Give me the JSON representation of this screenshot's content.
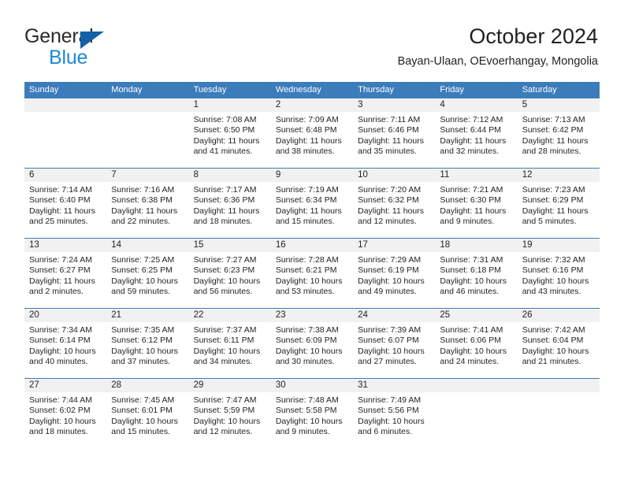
{
  "brand": {
    "name_part1": "General",
    "name_part2": "Blue",
    "accent_color": "#2089d4",
    "triangle_color": "#1461a8",
    "logo_icon": "triangle-icon"
  },
  "header": {
    "title": "October 2024",
    "subtitle": "Bayan-Ulaan, OEvoerhangay, Mongolia"
  },
  "theme": {
    "header_row_bg": "#3b7cbb",
    "day_band_bg": "#f1f1f1",
    "text_color": "#231f20"
  },
  "calendar": {
    "weekday_headers": [
      "Sunday",
      "Monday",
      "Tuesday",
      "Wednesday",
      "Thursday",
      "Friday",
      "Saturday"
    ],
    "weeks": [
      [
        {
          "day": "",
          "lines": []
        },
        {
          "day": "",
          "lines": []
        },
        {
          "day": "1",
          "lines": [
            "Sunrise: 7:08 AM",
            "Sunset: 6:50 PM",
            "Daylight: 11 hours",
            "and 41 minutes."
          ]
        },
        {
          "day": "2",
          "lines": [
            "Sunrise: 7:09 AM",
            "Sunset: 6:48 PM",
            "Daylight: 11 hours",
            "and 38 minutes."
          ]
        },
        {
          "day": "3",
          "lines": [
            "Sunrise: 7:11 AM",
            "Sunset: 6:46 PM",
            "Daylight: 11 hours",
            "and 35 minutes."
          ]
        },
        {
          "day": "4",
          "lines": [
            "Sunrise: 7:12 AM",
            "Sunset: 6:44 PM",
            "Daylight: 11 hours",
            "and 32 minutes."
          ]
        },
        {
          "day": "5",
          "lines": [
            "Sunrise: 7:13 AM",
            "Sunset: 6:42 PM",
            "Daylight: 11 hours",
            "and 28 minutes."
          ]
        }
      ],
      [
        {
          "day": "6",
          "lines": [
            "Sunrise: 7:14 AM",
            "Sunset: 6:40 PM",
            "Daylight: 11 hours",
            "and 25 minutes."
          ]
        },
        {
          "day": "7",
          "lines": [
            "Sunrise: 7:16 AM",
            "Sunset: 6:38 PM",
            "Daylight: 11 hours",
            "and 22 minutes."
          ]
        },
        {
          "day": "8",
          "lines": [
            "Sunrise: 7:17 AM",
            "Sunset: 6:36 PM",
            "Daylight: 11 hours",
            "and 18 minutes."
          ]
        },
        {
          "day": "9",
          "lines": [
            "Sunrise: 7:19 AM",
            "Sunset: 6:34 PM",
            "Daylight: 11 hours",
            "and 15 minutes."
          ]
        },
        {
          "day": "10",
          "lines": [
            "Sunrise: 7:20 AM",
            "Sunset: 6:32 PM",
            "Daylight: 11 hours",
            "and 12 minutes."
          ]
        },
        {
          "day": "11",
          "lines": [
            "Sunrise: 7:21 AM",
            "Sunset: 6:30 PM",
            "Daylight: 11 hours",
            "and 9 minutes."
          ]
        },
        {
          "day": "12",
          "lines": [
            "Sunrise: 7:23 AM",
            "Sunset: 6:29 PM",
            "Daylight: 11 hours",
            "and 5 minutes."
          ]
        }
      ],
      [
        {
          "day": "13",
          "lines": [
            "Sunrise: 7:24 AM",
            "Sunset: 6:27 PM",
            "Daylight: 11 hours",
            "and 2 minutes."
          ]
        },
        {
          "day": "14",
          "lines": [
            "Sunrise: 7:25 AM",
            "Sunset: 6:25 PM",
            "Daylight: 10 hours",
            "and 59 minutes."
          ]
        },
        {
          "day": "15",
          "lines": [
            "Sunrise: 7:27 AM",
            "Sunset: 6:23 PM",
            "Daylight: 10 hours",
            "and 56 minutes."
          ]
        },
        {
          "day": "16",
          "lines": [
            "Sunrise: 7:28 AM",
            "Sunset: 6:21 PM",
            "Daylight: 10 hours",
            "and 53 minutes."
          ]
        },
        {
          "day": "17",
          "lines": [
            "Sunrise: 7:29 AM",
            "Sunset: 6:19 PM",
            "Daylight: 10 hours",
            "and 49 minutes."
          ]
        },
        {
          "day": "18",
          "lines": [
            "Sunrise: 7:31 AM",
            "Sunset: 6:18 PM",
            "Daylight: 10 hours",
            "and 46 minutes."
          ]
        },
        {
          "day": "19",
          "lines": [
            "Sunrise: 7:32 AM",
            "Sunset: 6:16 PM",
            "Daylight: 10 hours",
            "and 43 minutes."
          ]
        }
      ],
      [
        {
          "day": "20",
          "lines": [
            "Sunrise: 7:34 AM",
            "Sunset: 6:14 PM",
            "Daylight: 10 hours",
            "and 40 minutes."
          ]
        },
        {
          "day": "21",
          "lines": [
            "Sunrise: 7:35 AM",
            "Sunset: 6:12 PM",
            "Daylight: 10 hours",
            "and 37 minutes."
          ]
        },
        {
          "day": "22",
          "lines": [
            "Sunrise: 7:37 AM",
            "Sunset: 6:11 PM",
            "Daylight: 10 hours",
            "and 34 minutes."
          ]
        },
        {
          "day": "23",
          "lines": [
            "Sunrise: 7:38 AM",
            "Sunset: 6:09 PM",
            "Daylight: 10 hours",
            "and 30 minutes."
          ]
        },
        {
          "day": "24",
          "lines": [
            "Sunrise: 7:39 AM",
            "Sunset: 6:07 PM",
            "Daylight: 10 hours",
            "and 27 minutes."
          ]
        },
        {
          "day": "25",
          "lines": [
            "Sunrise: 7:41 AM",
            "Sunset: 6:06 PM",
            "Daylight: 10 hours",
            "and 24 minutes."
          ]
        },
        {
          "day": "26",
          "lines": [
            "Sunrise: 7:42 AM",
            "Sunset: 6:04 PM",
            "Daylight: 10 hours",
            "and 21 minutes."
          ]
        }
      ],
      [
        {
          "day": "27",
          "lines": [
            "Sunrise: 7:44 AM",
            "Sunset: 6:02 PM",
            "Daylight: 10 hours",
            "and 18 minutes."
          ]
        },
        {
          "day": "28",
          "lines": [
            "Sunrise: 7:45 AM",
            "Sunset: 6:01 PM",
            "Daylight: 10 hours",
            "and 15 minutes."
          ]
        },
        {
          "day": "29",
          "lines": [
            "Sunrise: 7:47 AM",
            "Sunset: 5:59 PM",
            "Daylight: 10 hours",
            "and 12 minutes."
          ]
        },
        {
          "day": "30",
          "lines": [
            "Sunrise: 7:48 AM",
            "Sunset: 5:58 PM",
            "Daylight: 10 hours",
            "and 9 minutes."
          ]
        },
        {
          "day": "31",
          "lines": [
            "Sunrise: 7:49 AM",
            "Sunset: 5:56 PM",
            "Daylight: 10 hours",
            "and 6 minutes."
          ]
        },
        {
          "day": "",
          "lines": []
        },
        {
          "day": "",
          "lines": []
        }
      ]
    ]
  }
}
